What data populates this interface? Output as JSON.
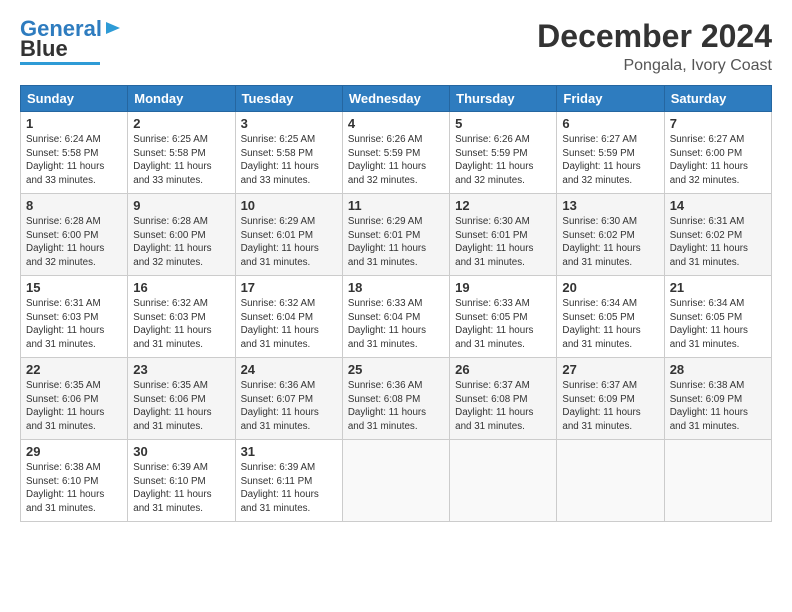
{
  "logo": {
    "line1": "General",
    "line2": "Blue"
  },
  "title": "December 2024",
  "subtitle": "Pongala, Ivory Coast",
  "weekdays": [
    "Sunday",
    "Monday",
    "Tuesday",
    "Wednesday",
    "Thursday",
    "Friday",
    "Saturday"
  ],
  "weeks": [
    [
      {
        "day": "1",
        "info": "Sunrise: 6:24 AM\nSunset: 5:58 PM\nDaylight: 11 hours\nand 33 minutes."
      },
      {
        "day": "2",
        "info": "Sunrise: 6:25 AM\nSunset: 5:58 PM\nDaylight: 11 hours\nand 33 minutes."
      },
      {
        "day": "3",
        "info": "Sunrise: 6:25 AM\nSunset: 5:58 PM\nDaylight: 11 hours\nand 33 minutes."
      },
      {
        "day": "4",
        "info": "Sunrise: 6:26 AM\nSunset: 5:59 PM\nDaylight: 11 hours\nand 32 minutes."
      },
      {
        "day": "5",
        "info": "Sunrise: 6:26 AM\nSunset: 5:59 PM\nDaylight: 11 hours\nand 32 minutes."
      },
      {
        "day": "6",
        "info": "Sunrise: 6:27 AM\nSunset: 5:59 PM\nDaylight: 11 hours\nand 32 minutes."
      },
      {
        "day": "7",
        "info": "Sunrise: 6:27 AM\nSunset: 6:00 PM\nDaylight: 11 hours\nand 32 minutes."
      }
    ],
    [
      {
        "day": "8",
        "info": "Sunrise: 6:28 AM\nSunset: 6:00 PM\nDaylight: 11 hours\nand 32 minutes."
      },
      {
        "day": "9",
        "info": "Sunrise: 6:28 AM\nSunset: 6:00 PM\nDaylight: 11 hours\nand 32 minutes."
      },
      {
        "day": "10",
        "info": "Sunrise: 6:29 AM\nSunset: 6:01 PM\nDaylight: 11 hours\nand 31 minutes."
      },
      {
        "day": "11",
        "info": "Sunrise: 6:29 AM\nSunset: 6:01 PM\nDaylight: 11 hours\nand 31 minutes."
      },
      {
        "day": "12",
        "info": "Sunrise: 6:30 AM\nSunset: 6:01 PM\nDaylight: 11 hours\nand 31 minutes."
      },
      {
        "day": "13",
        "info": "Sunrise: 6:30 AM\nSunset: 6:02 PM\nDaylight: 11 hours\nand 31 minutes."
      },
      {
        "day": "14",
        "info": "Sunrise: 6:31 AM\nSunset: 6:02 PM\nDaylight: 11 hours\nand 31 minutes."
      }
    ],
    [
      {
        "day": "15",
        "info": "Sunrise: 6:31 AM\nSunset: 6:03 PM\nDaylight: 11 hours\nand 31 minutes."
      },
      {
        "day": "16",
        "info": "Sunrise: 6:32 AM\nSunset: 6:03 PM\nDaylight: 11 hours\nand 31 minutes."
      },
      {
        "day": "17",
        "info": "Sunrise: 6:32 AM\nSunset: 6:04 PM\nDaylight: 11 hours\nand 31 minutes."
      },
      {
        "day": "18",
        "info": "Sunrise: 6:33 AM\nSunset: 6:04 PM\nDaylight: 11 hours\nand 31 minutes."
      },
      {
        "day": "19",
        "info": "Sunrise: 6:33 AM\nSunset: 6:05 PM\nDaylight: 11 hours\nand 31 minutes."
      },
      {
        "day": "20",
        "info": "Sunrise: 6:34 AM\nSunset: 6:05 PM\nDaylight: 11 hours\nand 31 minutes."
      },
      {
        "day": "21",
        "info": "Sunrise: 6:34 AM\nSunset: 6:05 PM\nDaylight: 11 hours\nand 31 minutes."
      }
    ],
    [
      {
        "day": "22",
        "info": "Sunrise: 6:35 AM\nSunset: 6:06 PM\nDaylight: 11 hours\nand 31 minutes."
      },
      {
        "day": "23",
        "info": "Sunrise: 6:35 AM\nSunset: 6:06 PM\nDaylight: 11 hours\nand 31 minutes."
      },
      {
        "day": "24",
        "info": "Sunrise: 6:36 AM\nSunset: 6:07 PM\nDaylight: 11 hours\nand 31 minutes."
      },
      {
        "day": "25",
        "info": "Sunrise: 6:36 AM\nSunset: 6:08 PM\nDaylight: 11 hours\nand 31 minutes."
      },
      {
        "day": "26",
        "info": "Sunrise: 6:37 AM\nSunset: 6:08 PM\nDaylight: 11 hours\nand 31 minutes."
      },
      {
        "day": "27",
        "info": "Sunrise: 6:37 AM\nSunset: 6:09 PM\nDaylight: 11 hours\nand 31 minutes."
      },
      {
        "day": "28",
        "info": "Sunrise: 6:38 AM\nSunset: 6:09 PM\nDaylight: 11 hours\nand 31 minutes."
      }
    ],
    [
      {
        "day": "29",
        "info": "Sunrise: 6:38 AM\nSunset: 6:10 PM\nDaylight: 11 hours\nand 31 minutes."
      },
      {
        "day": "30",
        "info": "Sunrise: 6:39 AM\nSunset: 6:10 PM\nDaylight: 11 hours\nand 31 minutes."
      },
      {
        "day": "31",
        "info": "Sunrise: 6:39 AM\nSunset: 6:11 PM\nDaylight: 11 hours\nand 31 minutes."
      },
      {
        "day": "",
        "info": ""
      },
      {
        "day": "",
        "info": ""
      },
      {
        "day": "",
        "info": ""
      },
      {
        "day": "",
        "info": ""
      }
    ]
  ]
}
